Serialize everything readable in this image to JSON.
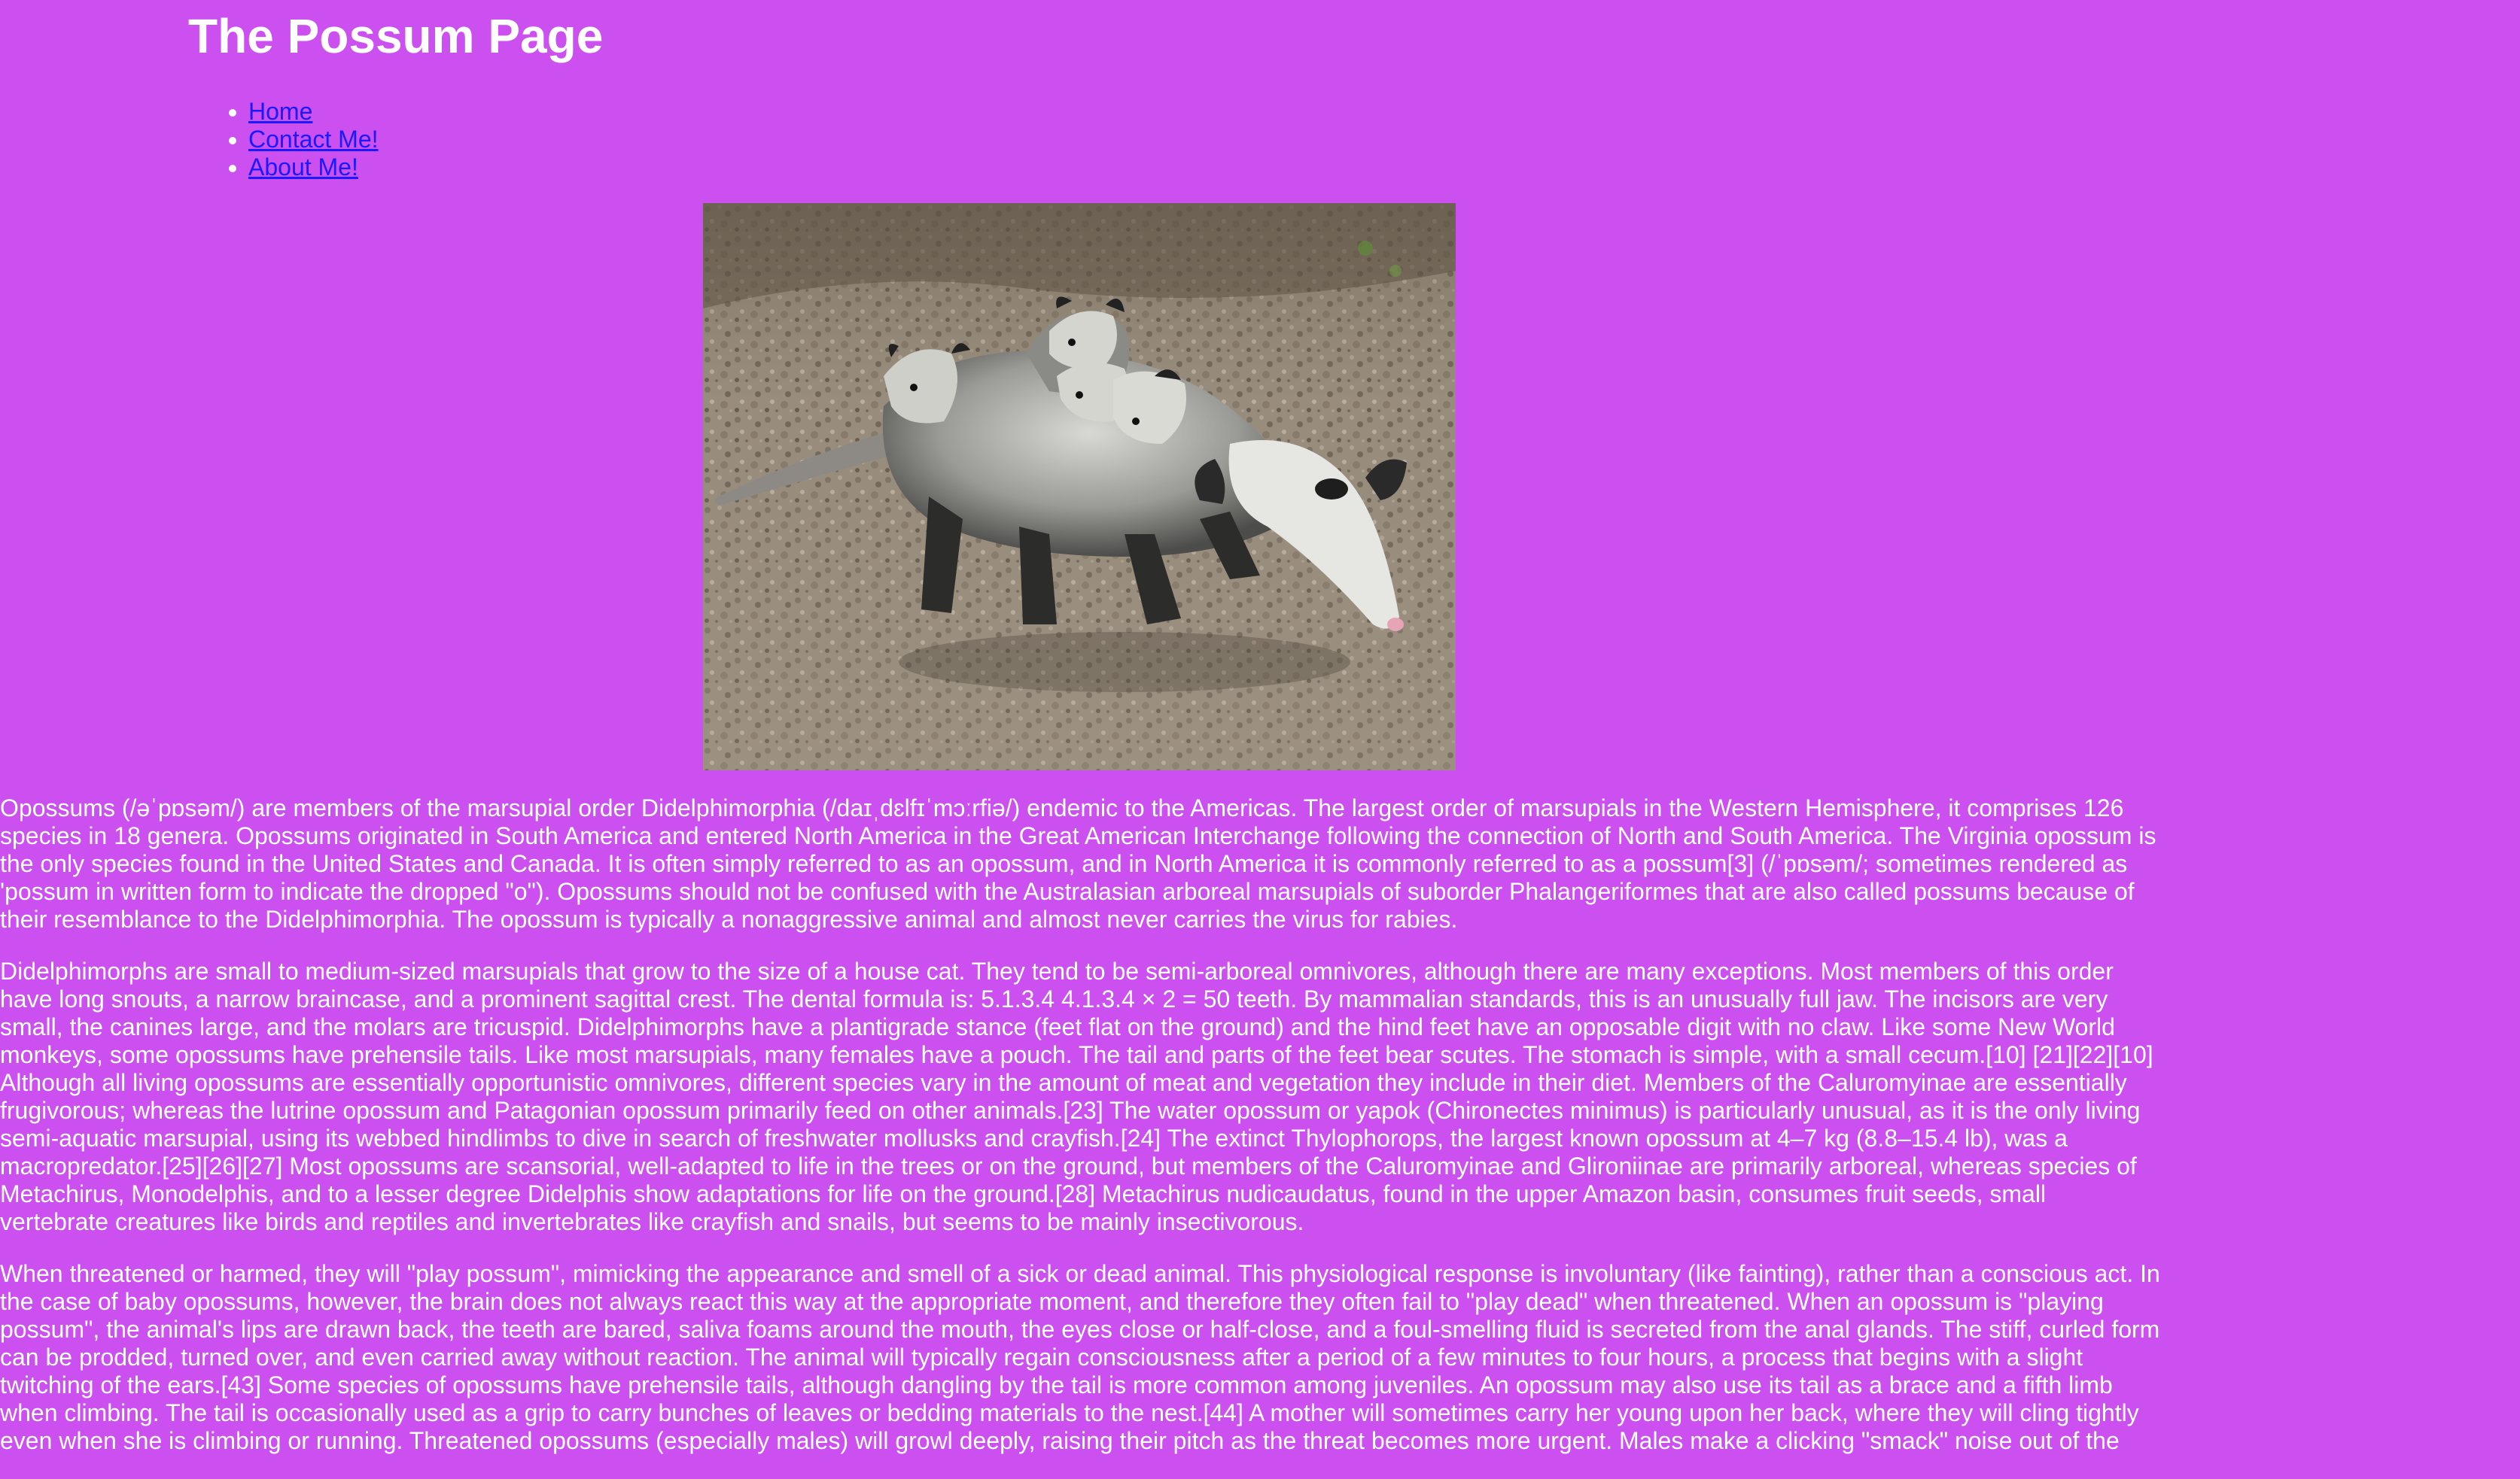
{
  "page": {
    "title": "The Possum Page"
  },
  "nav": {
    "items": [
      {
        "label": "Home"
      },
      {
        "label": "Contact Me!"
      },
      {
        "label": "About Me!"
      }
    ]
  },
  "hero_image": {
    "subject": "opossum-carrying-babies-photo"
  },
  "content": {
    "paragraphs": [
      "Opossums (/əˈpɒsəm/) are members of the marsupial order Didelphimorphia (/daɪˌdɛlfɪˈmɔːrfiə/) endemic to the Americas. The largest order of marsupials in the Western Hemisphere, it comprises 126 species in 18 genera. Opossums originated in South America and entered North America in the Great American Interchange following the connection of North and South America. The Virginia opossum is the only species found in the United States and Canada. It is often simply referred to as an opossum, and in North America it is commonly referred to as a possum[3] (/ˈpɒsəm/; sometimes rendered as 'possum in written form to indicate the dropped \"o\"). Opossums should not be confused with the Australasian arboreal marsupials of suborder Phalangeriformes that are also called possums because of their resemblance to the Didelphimorphia. The opossum is typically a nonaggressive animal and almost never carries the virus for rabies.",
      "Didelphimorphs are small to medium-sized marsupials that grow to the size of a house cat. They tend to be semi-arboreal omnivores, although there are many exceptions. Most members of this order have long snouts, a narrow braincase, and a prominent sagittal crest. The dental formula is: 5.1.3.4 4.1.3.4 × 2 = 50 teeth. By mammalian standards, this is an unusually full jaw. The incisors are very small, the canines large, and the molars are tricuspid. Didelphimorphs have a plantigrade stance (feet flat on the ground) and the hind feet have an opposable digit with no claw. Like some New World monkeys, some opossums have prehensile tails. Like most marsupials, many females have a pouch. The tail and parts of the feet bear scutes. The stomach is simple, with a small cecum.[10] [21][22][10] Although all living opossums are essentially opportunistic omnivores, different species vary in the amount of meat and vegetation they include in their diet. Members of the Caluromyinae are essentially frugivorous; whereas the lutrine opossum and Patagonian opossum primarily feed on other animals.[23] The water opossum or yapok (Chironectes minimus) is particularly unusual, as it is the only living semi-aquatic marsupial, using its webbed hindlimbs to dive in search of freshwater mollusks and crayfish.[24] The extinct Thylophorops, the largest known opossum at 4–7 kg (8.8–15.4 lb), was a macropredator.[25][26][27] Most opossums are scansorial, well-adapted to life in the trees or on the ground, but members of the Caluromyinae and Glironiinae are primarily arboreal, whereas species of Metachirus, Monodelphis, and to a lesser degree Didelphis show adaptations for life on the ground.[28] Metachirus nudicaudatus, found in the upper Amazon basin, consumes fruit seeds, small vertebrate creatures like birds and reptiles and invertebrates like crayfish and snails, but seems to be mainly insectivorous.",
      "When threatened or harmed, they will \"play possum\", mimicking the appearance and smell of a sick or dead animal. This physiological response is involuntary (like fainting), rather than a conscious act. In the case of baby opossums, however, the brain does not always react this way at the appropriate moment, and therefore they often fail to \"play dead\" when threatened. When an opossum is \"playing possum\", the animal's lips are drawn back, the teeth are bared, saliva foams around the mouth, the eyes close or half-close, and a foul-smelling fluid is secreted from the anal glands. The stiff, curled form can be prodded, turned over, and even carried away without reaction. The animal will typically regain consciousness after a period of a few minutes to four hours, a process that begins with a slight twitching of the ears.[43] Some species of opossums have prehensile tails, although dangling by the tail is more common among juveniles. An opossum may also use its tail as a brace and a fifth limb when climbing. The tail is occasionally used as a grip to carry bunches of leaves or bedding materials to the nest.[44] A mother will sometimes carry her young upon her back, where they will cling tightly even when she is climbing or running. Threatened opossums (especially males) will growl deeply, raising their pitch as the threat becomes more urgent. Males make a clicking \"smack\" noise out of the"
    ]
  },
  "colors": {
    "background": "#cc4ff0",
    "text": "#ffffff",
    "link": "#1a1aff"
  }
}
